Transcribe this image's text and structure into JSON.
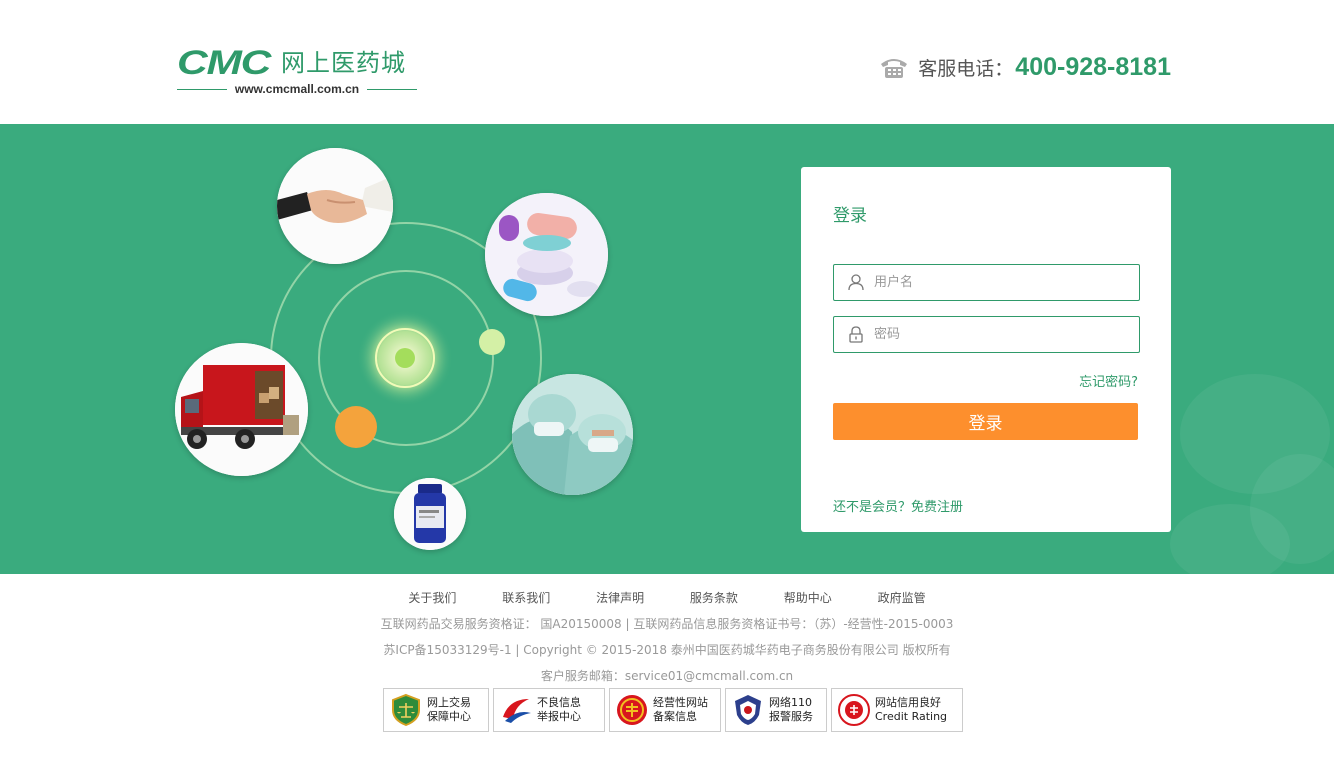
{
  "header": {
    "logo_brand": "CMC",
    "logo_name": "网上医药城",
    "logo_url": "www.cmcmall.com.cn",
    "hotline_label": "客服电话：",
    "hotline_number": "400-928-8181"
  },
  "login": {
    "title": "登录",
    "username_placeholder": "用户名",
    "password_placeholder": "密码",
    "forgot_label": "忘记密码?",
    "submit_label": "登录",
    "register_label": "还不是会员？免费注册"
  },
  "footer": {
    "links": [
      "关于我们",
      "联系我们",
      "法律声明",
      "服务条款",
      "帮助中心",
      "政府监管"
    ],
    "line1": "互联网药品交易服务资格证： 国A20150008 | 互联网药品信息服务资格证书号：（苏）-经营性-2015-0003",
    "line2": "苏ICP备15033129号-1 | Copyright © 2015-2018 泰州中国医药城华药电子商务股份有限公司 版权所有",
    "line3": "客户服务邮箱：service01@cmcmall.com.cn",
    "badges": [
      {
        "line1": "网上交易",
        "line2": "保障中心",
        "icon": "shield-scale-icon"
      },
      {
        "line1": "不良信息",
        "line2": "举报中心",
        "icon": "report-swoosh-icon"
      },
      {
        "line1": "经营性网站",
        "line2": "备案信息",
        "icon": "red-seal-icon"
      },
      {
        "line1": "网络110",
        "line2": "报警服务",
        "icon": "police-badge-icon"
      },
      {
        "line1": "网站信用良好",
        "line2": "Credit Rating",
        "icon": "trust-stamp-icon"
      }
    ]
  },
  "colors": {
    "brand_green": "#2f9a6a",
    "banner_green": "#3aab7e",
    "login_button": "#fd8f2d"
  }
}
